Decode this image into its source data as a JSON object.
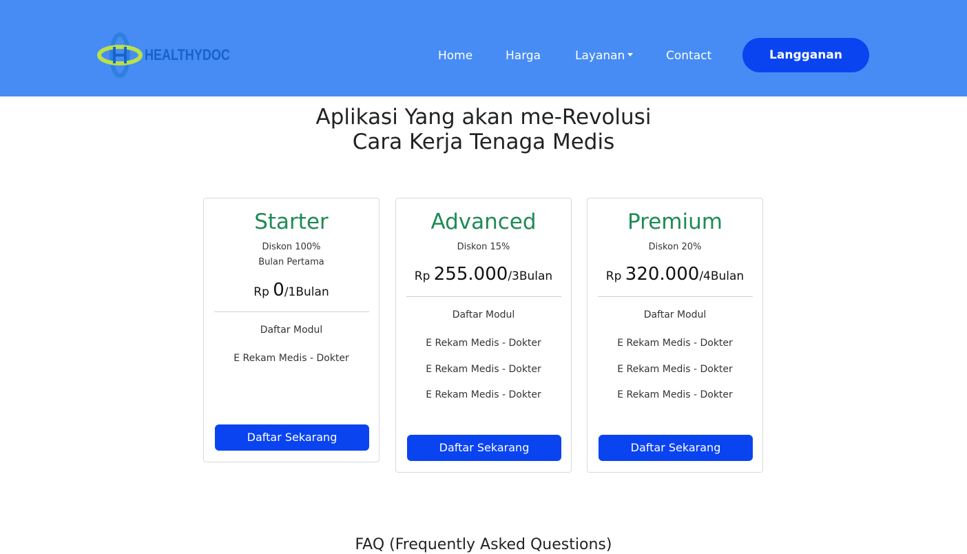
{
  "brand": {
    "name": "HEALTHYDOC",
    "logo_icon": "cross-rings-logo",
    "colors": {
      "navbar": "#468cf4",
      "primary_button": "#0a44f0",
      "plan_name": "#1f8a55"
    }
  },
  "nav": {
    "items": [
      {
        "label": "Home"
      },
      {
        "label": "Harga"
      },
      {
        "label": "Layanan"
      },
      {
        "label": "Contact"
      }
    ],
    "cta_label": "Langganan"
  },
  "hero": {
    "line1": "Aplikasi Yang akan me-Revolusi",
    "line2": "Cara Kerja Tenaga Medis"
  },
  "plans": [
    {
      "name": "Starter",
      "discount_lines": [
        "Diskon 100%",
        "Bulan Pertama"
      ],
      "currency": "Rp",
      "amount": "0",
      "period": "/1Bulan",
      "modules_title": "Daftar Modul",
      "modules": [
        "E Rekam Medis - Dokter"
      ],
      "button_label": "Daftar Sekarang"
    },
    {
      "name": "Advanced",
      "discount_lines": [
        "Diskon 15%"
      ],
      "currency": "Rp",
      "amount": "255.000",
      "period": "/3Bulan",
      "modules_title": "Daftar Modul",
      "modules": [
        "E Rekam Medis - Dokter",
        "E Rekam Medis - Dokter",
        "E Rekam Medis - Dokter"
      ],
      "button_label": "Daftar Sekarang"
    },
    {
      "name": "Premium",
      "discount_lines": [
        "Diskon 20%"
      ],
      "currency": "Rp",
      "amount": "320.000",
      "period": "/4Bulan",
      "modules_title": "Daftar Modul",
      "modules": [
        "E Rekam Medis - Dokter",
        "E Rekam Medis - Dokter",
        "E Rekam Medis - Dokter"
      ],
      "button_label": "Daftar Sekarang"
    }
  ],
  "faq": {
    "title": "FAQ (Frequently Asked Questions)"
  }
}
